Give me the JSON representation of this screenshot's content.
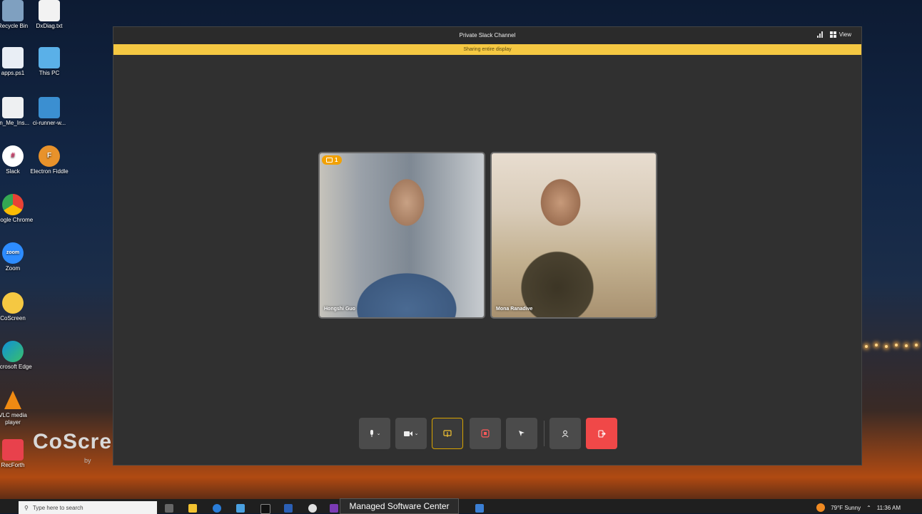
{
  "desktop": {
    "icons": [
      {
        "label": "Recycle Bin"
      },
      {
        "label": "DxDiag.txt"
      },
      {
        "label": "apps.ps1"
      },
      {
        "label": "This PC"
      },
      {
        "label": "un_Me_Ins..."
      },
      {
        "label": "ci-runner-w..."
      },
      {
        "label": "Slack"
      },
      {
        "label": "Electron Fiddle"
      },
      {
        "label": "Google Chrome"
      },
      {
        "label": "Zoom"
      },
      {
        "label": "CoScreen"
      },
      {
        "label": "Microsoft Edge"
      },
      {
        "label": "VLC media player"
      },
      {
        "label": "RecForth"
      }
    ],
    "brand": "CoScre",
    "brand_sub": "by"
  },
  "window": {
    "title": "Private Slack Channel",
    "view_label": "View",
    "banner": "Sharing entire display",
    "badge_count": "1",
    "participants": [
      {
        "name": "Hongshi Guo"
      },
      {
        "name": "Mona Ranadive"
      }
    ]
  },
  "toolbar": {
    "buttons": [
      "microphone",
      "camera",
      "share-screen",
      "stop-share",
      "pointer",
      "add-participant",
      "leave"
    ]
  },
  "taskbar": {
    "search_placeholder": "Type here to search",
    "tooltip": "Managed Software Center",
    "weather": "79°F  Sunny",
    "time": "11:36 AM"
  }
}
